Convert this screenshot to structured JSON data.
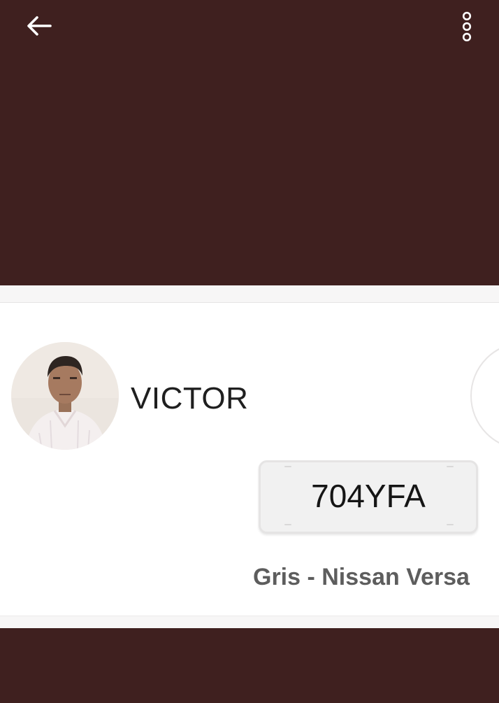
{
  "header": {
    "back_icon": "arrow-left-icon",
    "menu_icon": "more-vertical-icon",
    "background_color": "#3f201f"
  },
  "driver": {
    "name": "VICTOR",
    "photo_icon": "driver-photo"
  },
  "vehicle": {
    "plate": "704YFA",
    "description": "Gris - Nissan Versa"
  },
  "colors": {
    "panel": "#3f201f",
    "plate_text": "#151515",
    "vehicle_text": "#5d5d5d"
  }
}
